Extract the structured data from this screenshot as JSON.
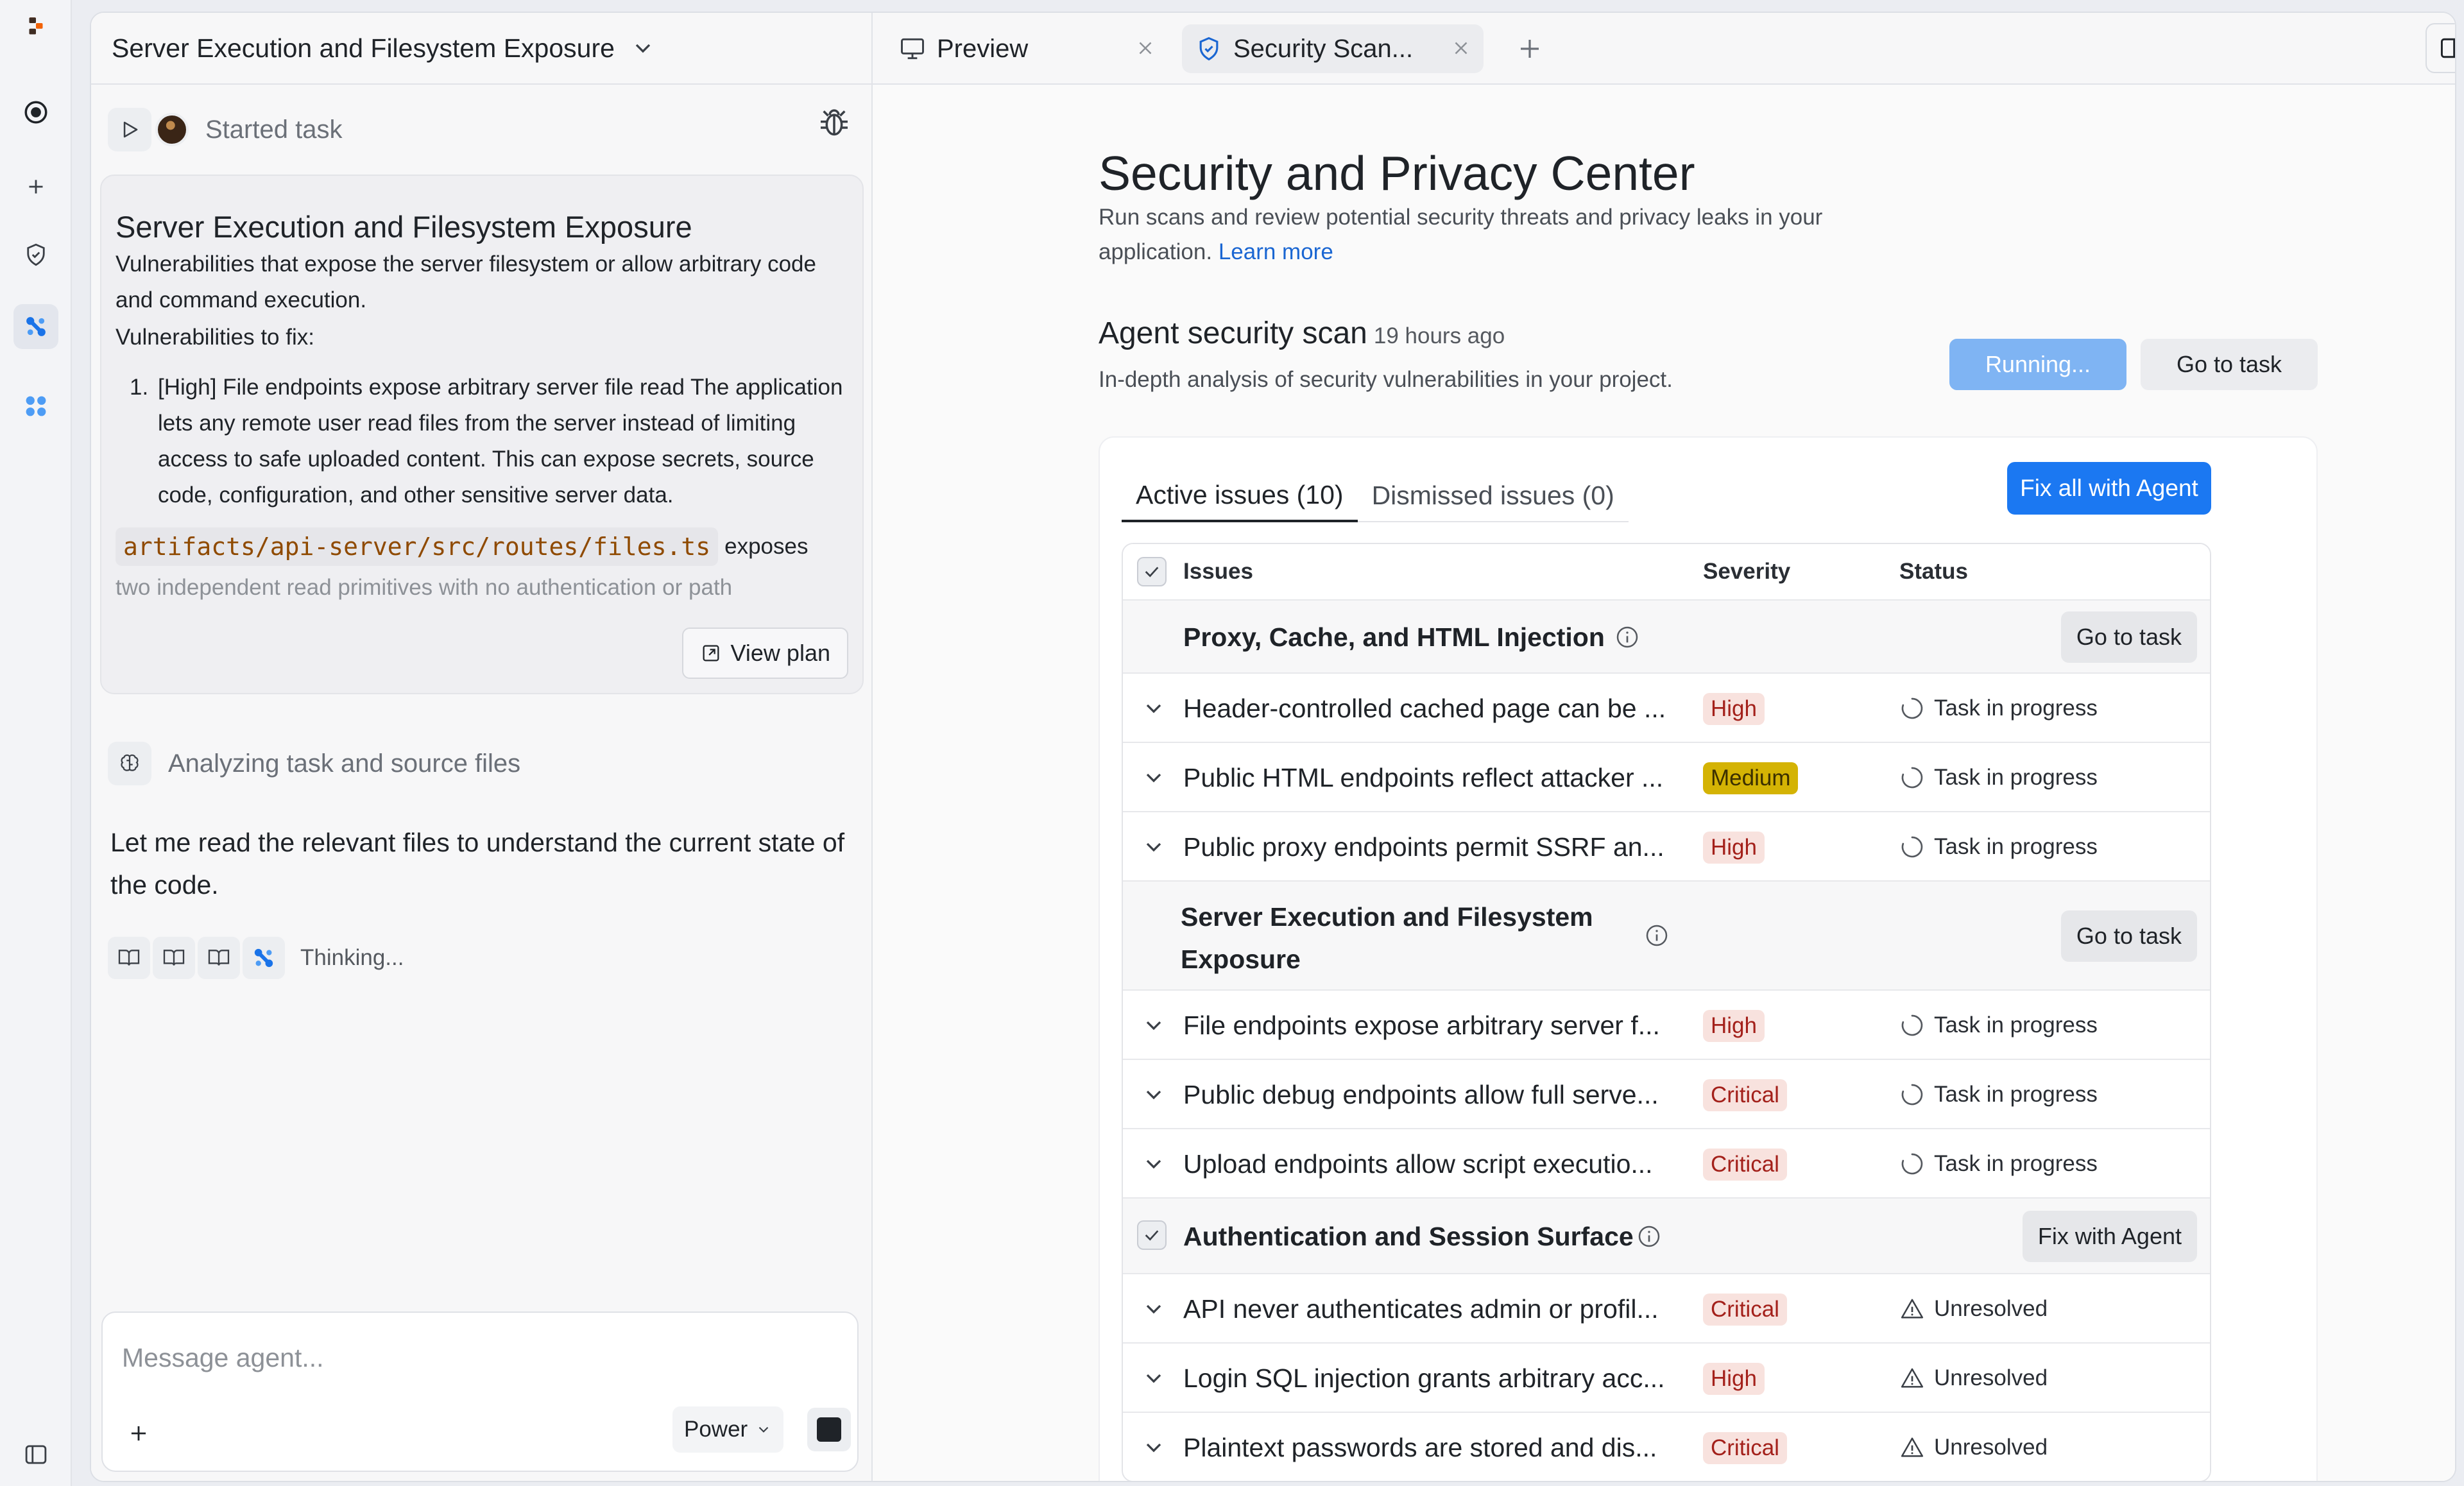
{
  "rail": {
    "icons": [
      "replit-logo-icon",
      "record-icon",
      "plus-icon",
      "shield-icon",
      "agent-icon",
      "apps-icon",
      "sidebar-toggle-icon"
    ]
  },
  "left": {
    "title": "Server Execution and Filesystem Exposure",
    "started_label": "Started task",
    "card": {
      "heading": "Server Execution and Filesystem Exposure",
      "intro": "Vulnerabilities that expose the server filesystem or allow arbitrary code and command execution.",
      "fix_label": "Vulnerabilities to fix:",
      "item_number": "1.",
      "item_text": "[High] File endpoints expose arbitrary server file read The application lets any remote user read files from the server instead of limiting access to safe uploaded content. This can expose secrets, source code, configuration, and other sensitive server data.",
      "code": "artifacts/api-server/src/routes/files.ts",
      "code_after": "exposes",
      "faded": "two independent read primitives with no authentication or path",
      "view_plan": "View plan"
    },
    "analyzing_label": "Analyzing task and source files",
    "agent_message": "Let me read the relevant files to understand the current state of the code.",
    "thinking_label": "Thinking...",
    "composer": {
      "placeholder": "Message agent...",
      "mode": "Power"
    }
  },
  "tabs": [
    {
      "label": "Preview",
      "icon": "monitor-icon"
    },
    {
      "label": "Security Scan...",
      "icon": "shield-check-icon"
    }
  ],
  "security": {
    "title": "Security and Privacy Center",
    "subtitle": "Run scans and review potential security threats and privacy leaks in your application.",
    "learn_more": "Learn more",
    "scan": {
      "title": "Agent security scan",
      "time": "19 hours ago",
      "description": "In-depth analysis of security vulnerabilities in your project.",
      "running_label": "Running...",
      "goto_label": "Go to task"
    },
    "tabs": {
      "active": "Active issues (10)",
      "dismissed": "Dismissed issues (0)"
    },
    "fix_all": "Fix all with Agent",
    "table": {
      "headers": {
        "issues": "Issues",
        "severity": "Severity",
        "status": "Status"
      },
      "groups": [
        {
          "title": "Proxy, Cache, and HTML Injection",
          "action": "Go to task",
          "issues": [
            {
              "title": "Header-controlled cached page can be ...",
              "severity": "High",
              "status": "Task in progress"
            },
            {
              "title": "Public HTML endpoints reflect attacker ...",
              "severity": "Medium",
              "status": "Task in progress"
            },
            {
              "title": "Public proxy endpoints permit SSRF an...",
              "severity": "High",
              "status": "Task in progress"
            }
          ]
        },
        {
          "title_line1": "Server Execution and Filesystem",
          "title_line2": "Exposure",
          "action": "Go to task",
          "issues": [
            {
              "title": "File endpoints expose arbitrary server f...",
              "severity": "High",
              "status": "Task in progress"
            },
            {
              "title": "Public debug endpoints allow full serve...",
              "severity": "Critical",
              "status": "Task in progress"
            },
            {
              "title": "Upload endpoints allow script executio...",
              "severity": "Critical",
              "status": "Task in progress"
            }
          ]
        },
        {
          "title": "Authentication and Session Surface",
          "action": "Fix with Agent",
          "issues": [
            {
              "title": "API never authenticates admin or profil...",
              "severity": "Critical",
              "status": "Unresolved"
            },
            {
              "title": "Login SQL injection grants arbitrary acc...",
              "severity": "High",
              "status": "Unresolved"
            },
            {
              "title": "Plaintext passwords are stored and dis...",
              "severity": "Critical",
              "status": "Unresolved"
            }
          ]
        }
      ]
    }
  },
  "colors": {
    "accent": "#1b78f2",
    "running": "#7fb4f3",
    "critical_bg": "#f8e2de",
    "critical_fg": "#a3201a",
    "medium_bg": "#d4b304"
  }
}
